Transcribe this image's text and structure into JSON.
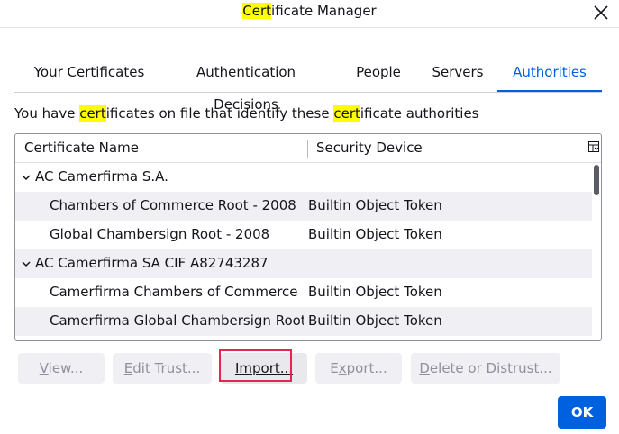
{
  "window": {
    "title_highlight": "Cert",
    "title_rest": "ificate Manager"
  },
  "tabs": [
    {
      "label": "Your Certificates"
    },
    {
      "label": "Authentication Decisions"
    },
    {
      "label": "People"
    },
    {
      "label": "Servers"
    },
    {
      "label": "Authorities",
      "selected": true
    }
  ],
  "description": {
    "p1": "You have ",
    "h1": "cert",
    "p2": "ificates on file that identify these ",
    "h2": "cert",
    "p3": "ificate authorities"
  },
  "tree": {
    "columns": [
      "Certificate Name",
      "Security Device"
    ],
    "rows": [
      {
        "name": "AC Camerfirma S.A.",
        "device": "",
        "group": true
      },
      {
        "name": "Chambers of Commerce Root - 2008",
        "device": "Builtin Object Token",
        "group": false
      },
      {
        "name": "Global Chambersign Root - 2008",
        "device": "Builtin Object Token",
        "group": false
      },
      {
        "name": "AC Camerfirma SA CIF A82743287",
        "device": "",
        "group": true
      },
      {
        "name": "Camerfirma Chambers of Commerce R...",
        "device": "Builtin Object Token",
        "group": false
      },
      {
        "name": "Camerfirma Global Chambersign Root",
        "device": "Builtin Object Token",
        "group": false
      }
    ]
  },
  "buttons": {
    "view_u": "V",
    "view_rest": "iew...",
    "edit_u": "E",
    "edit_rest": "dit Trust...",
    "import_u": "I",
    "import_mid": "m",
    "import_rest": "port...",
    "export_u": "x",
    "export_pre": "E",
    "export_rest": "port...",
    "delete_u": "D",
    "delete_rest": "elete or Distrust...",
    "ok": "OK"
  },
  "colors": {
    "accent": "#0061e0",
    "highlight": "#ffff00",
    "focus_box": "#e22850"
  }
}
